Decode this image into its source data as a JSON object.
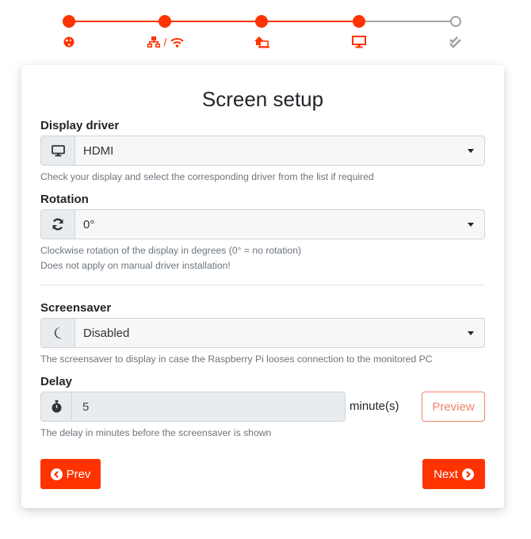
{
  "stepper": {
    "steps": [
      {
        "name": "language",
        "icon": "globe-icon",
        "state": "done"
      },
      {
        "name": "network",
        "icon": "network-wifi-icon",
        "separator": "/",
        "state": "done"
      },
      {
        "name": "remote-host",
        "icon": "house-laptop-icon",
        "state": "done"
      },
      {
        "name": "screen",
        "icon": "desktop-icon",
        "state": "current"
      },
      {
        "name": "finish",
        "icon": "check-double-icon",
        "state": "todo"
      }
    ],
    "separator": "/",
    "active_color": "#ff3300",
    "inactive_color": "#9ea3a8"
  },
  "card": {
    "title": "Screen setup",
    "display_driver": {
      "label": "Display driver",
      "value": "HDMI",
      "icon": "desktop-icon",
      "help": "Check your display and select the corresponding driver from the list if required"
    },
    "rotation": {
      "label": "Rotation",
      "value": "0°",
      "icon": "sync-icon",
      "help_lines": [
        "Clockwise rotation of the display in degrees (0° = no rotation)",
        "Does not apply on manual driver installation!"
      ]
    },
    "screensaver": {
      "label": "Screensaver",
      "value": "Disabled",
      "icon": "moon-icon",
      "help": "The screensaver to display in case the Raspberry Pi looses connection to the monitored PC"
    },
    "delay": {
      "label": "Delay",
      "value": "5",
      "icon": "stopwatch-icon",
      "unit": "minute(s)",
      "preview_label": "Preview",
      "help": "The delay in minutes before the screensaver is shown"
    },
    "prev_label": "Prev",
    "next_label": "Next"
  },
  "colors": {
    "accent": "#ff3300",
    "preview_outline": "#f0846a",
    "help_text": "#6c757d"
  }
}
